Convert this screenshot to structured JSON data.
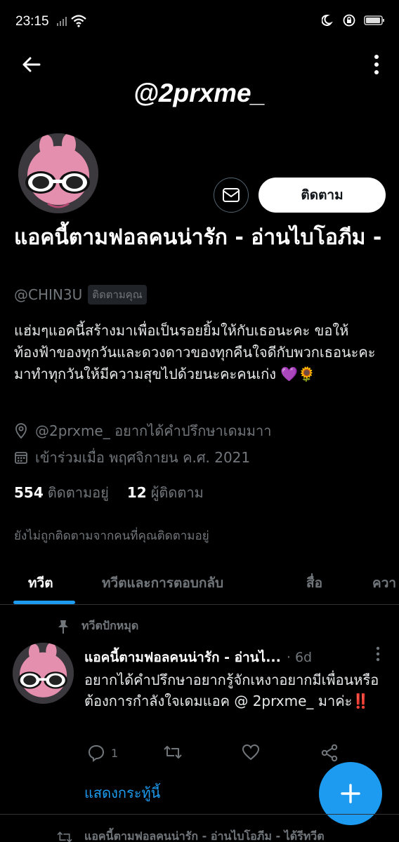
{
  "status_bar": {
    "time": "23:15",
    "battery_icon": "battery-icon",
    "wifi_icon": "wifi-icon"
  },
  "header": {
    "back_icon": "arrow-left-icon",
    "more_icon": "more-vertical-icon",
    "banner_text": "@2prxme_"
  },
  "profile": {
    "message_icon": "mail-icon",
    "follow_label": "ติดตาม",
    "display_name": "แอคนี้ตามฟอลคนน่ารัก - อ่านไบโอภีม -",
    "handle": "@CHIN3U",
    "follows_you": "ติดตามคุณ",
    "bio": "แฮ่มๆแอคนี้สร้างมาเพื่อเป็นรอยยิ้มให้กับเธอนะคะ ขอให้ท้องฟ้าของทุกวันและดวงดาวของทุกคืนใจดีกับพวกเธอนะคะ มาทำทุกวันให้มีความสุขไปด้วยนะคะคนเก่ง 💜🌻",
    "location": "@2prxme_ อยากได้คำปรึกษาเดมมาา",
    "joined": "เข้าร่วมเมื่อ พฤศจิกายน ค.ศ. 2021",
    "following_count": "554",
    "following_label": "ติดตามอยู่",
    "followers_count": "12",
    "followers_label": "ผู้ติดตาม",
    "not_followed_text": "ยังไม่ถูกติดตามจากคนที่คุณติดตามอยู่"
  },
  "tabs": [
    {
      "label": "ทวีต"
    },
    {
      "label": "ทวีตและการตอบกลับ"
    },
    {
      "label": "สื่อ"
    },
    {
      "label": "ควา"
    }
  ],
  "pinned_tweet": {
    "pinned_label": "ทวีตปักหมุด",
    "author_name": "แอคนี้ตามฟอลคนน่ารัก - อ่านไ...",
    "time": "· 6d",
    "text": "อยากได้คำปรึกษาอยากรู้จักเหงาอยากมีเพื่อนหรือต้องการกำลังใจเดมแอค @ 2prxme_ มาค่ะ‼️",
    "reply_count": "1",
    "show_thread": "แสดงกระทู้นี้"
  },
  "next_item": {
    "retweet_text": "แอคนี้ตามฟอลคนน่ารัก - อ่านไบโอภีม - ได้รีทวีต"
  },
  "colors": {
    "accent": "#1d9bf0",
    "background": "#000000",
    "muted": "#71767b"
  }
}
